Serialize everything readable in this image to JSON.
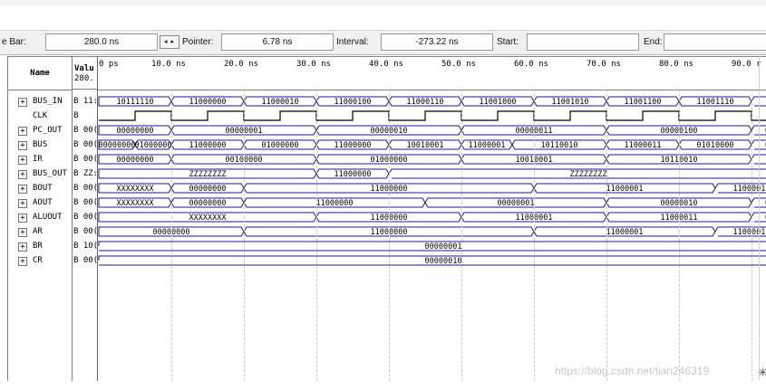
{
  "toolbar": {
    "time_bar_label": "e Bar:",
    "time_bar_value": "280.0 ns",
    "nav_arrows": "◂ ▸",
    "pointer_label": "Pointer:",
    "pointer_value": "6.78 ns",
    "interval_label": "Interval:",
    "interval_value": "-273.22 ns",
    "start_label": "Start:",
    "start_value": "",
    "end_label": "End:",
    "end_value": ""
  },
  "headers": {
    "name": "Name",
    "value_line1": "Valu",
    "value_line2": "280."
  },
  "time_ticks": [
    "0 ps",
    "10.0 ns",
    "20.0 ns",
    "30.0 ns",
    "40.0 ns",
    "50.0 ns",
    "60.0 ns",
    "70.0 ns",
    "80.0 ns",
    "90.0 r"
  ],
  "signals": [
    {
      "name": "BUS_IN",
      "value": "B 11:",
      "expandable": true
    },
    {
      "name": "CLK",
      "value": "B",
      "expandable": false
    },
    {
      "name": "PC_OUT",
      "value": "B 00(",
      "expandable": true
    },
    {
      "name": "BUS",
      "value": "B 00(",
      "expandable": true
    },
    {
      "name": "IR",
      "value": "B 00(",
      "expandable": true
    },
    {
      "name": "BUS_OUT",
      "value": "B ZZ:",
      "expandable": true
    },
    {
      "name": "BOUT",
      "value": "B 00(",
      "expandable": true
    },
    {
      "name": "AOUT",
      "value": "B 00(",
      "expandable": true
    },
    {
      "name": "ALUOUT",
      "value": "B 00(",
      "expandable": true
    },
    {
      "name": "AR",
      "value": "B 00(",
      "expandable": true
    },
    {
      "name": "BR",
      "value": "B 10(",
      "expandable": true
    },
    {
      "name": "CR",
      "value": "B 00(",
      "expandable": true
    }
  ],
  "waves": [
    {
      "segs": [
        [
          "10111110",
          0,
          10
        ],
        [
          "11000000",
          10,
          20
        ],
        [
          "11000010",
          20,
          30
        ],
        [
          "11000100",
          30,
          40
        ],
        [
          "11000110",
          40,
          50
        ],
        [
          "11001000",
          50,
          60
        ],
        [
          "11001010",
          60,
          70
        ],
        [
          "11001100",
          70,
          80
        ],
        [
          "11001110",
          80,
          90
        ],
        [
          "1(",
          90,
          95
        ]
      ]
    },
    {
      "clock": true
    },
    {
      "segs": [
        [
          "00000000",
          0,
          10
        ],
        [
          "00000001",
          10,
          30
        ],
        [
          "00000010",
          30,
          50
        ],
        [
          "00000011",
          50,
          70
        ],
        [
          "00000100",
          70,
          90
        ],
        [
          "00",
          90,
          95
        ]
      ]
    },
    {
      "segs": [
        [
          "00000000",
          0,
          5
        ],
        [
          "01000000",
          5,
          10
        ],
        [
          "11000000",
          10,
          20
        ],
        [
          "01000000",
          20,
          30
        ],
        [
          "11000000",
          30,
          40
        ],
        [
          "10010001",
          40,
          50
        ],
        [
          "11000001",
          50,
          57
        ],
        [
          "10110010",
          57,
          70
        ],
        [
          "11000011",
          70,
          80
        ],
        [
          "01010000",
          80,
          90
        ],
        [
          "01",
          90,
          95
        ]
      ]
    },
    {
      "segs": [
        [
          "00000000",
          0,
          10
        ],
        [
          "00100000",
          10,
          30
        ],
        [
          "01000000",
          30,
          50
        ],
        [
          "10010001",
          50,
          70
        ],
        [
          "10110010",
          70,
          90
        ],
        [
          "1(",
          90,
          95
        ]
      ]
    },
    {
      "segs": [
        [
          "ZZZZZZZZ",
          0,
          30
        ],
        [
          "11000000",
          30,
          40
        ],
        [
          "ZZZZZZZZ",
          40,
          95
        ]
      ]
    },
    {
      "segs": [
        [
          "XXXXXXXX",
          0,
          10
        ],
        [
          "00000000",
          10,
          20
        ],
        [
          "11000000",
          20,
          60
        ],
        [
          "11000001",
          60,
          85
        ],
        [
          "11000011",
          85,
          95
        ]
      ]
    },
    {
      "segs": [
        [
          "XXXXXXXX",
          0,
          10
        ],
        [
          "00000000",
          10,
          20
        ],
        [
          "11000000",
          20,
          45
        ],
        [
          "00000001",
          45,
          70
        ],
        [
          "00000010",
          70,
          90
        ],
        [
          "00",
          90,
          95
        ]
      ]
    },
    {
      "segs": [
        [
          "XXXXXXXX",
          0,
          30
        ],
        [
          "11000000",
          30,
          50
        ],
        [
          "11000001",
          50,
          70
        ],
        [
          "11000011",
          70,
          90
        ],
        [
          "01",
          90,
          95
        ]
      ]
    },
    {
      "segs": [
        [
          "00000000",
          0,
          20
        ],
        [
          "11000000",
          20,
          60
        ],
        [
          "11000001",
          60,
          85
        ],
        [
          "11000011",
          85,
          95
        ]
      ]
    },
    {
      "segs": [
        [
          "00000001",
          0,
          95
        ]
      ]
    },
    {
      "segs": [
        [
          "00000010",
          0,
          95
        ]
      ]
    }
  ],
  "watermark": "https://blog.csdn.net/tian246319",
  "colors": {
    "wave": "#1a1a8c",
    "clock": "#000000",
    "grid": "#c8c8c8"
  }
}
